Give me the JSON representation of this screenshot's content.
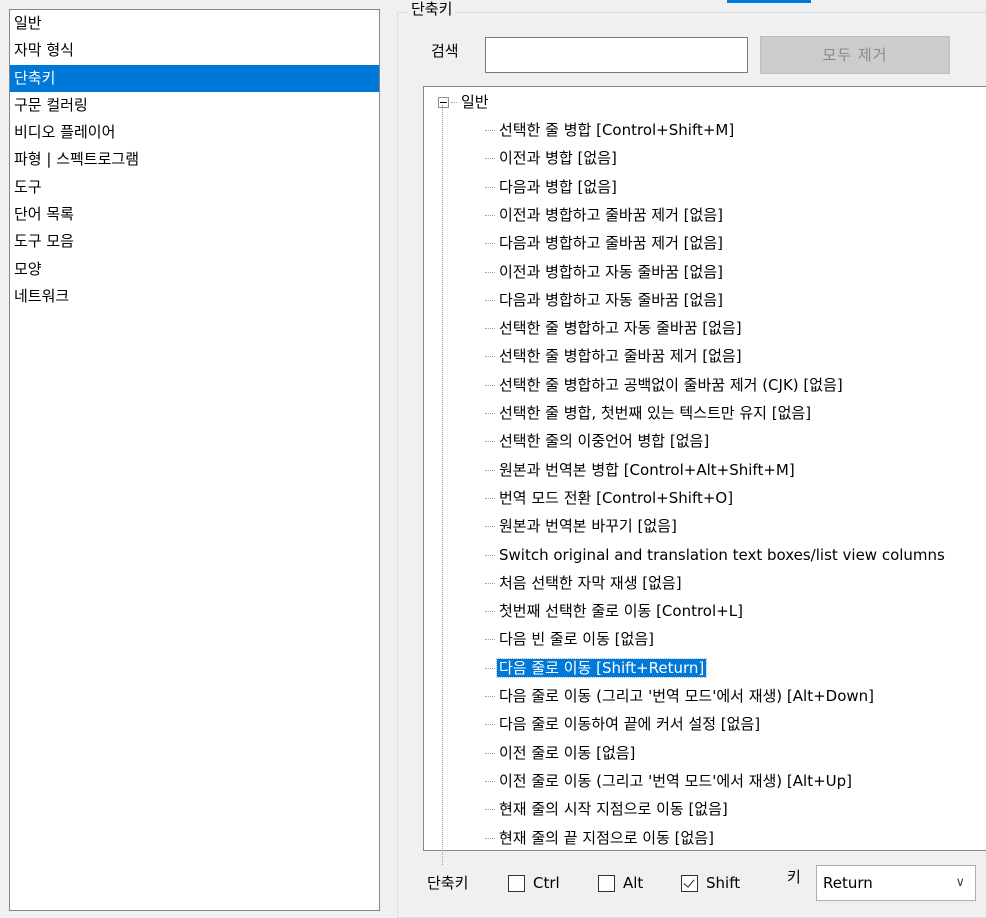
{
  "categories": [
    {
      "label": "일반"
    },
    {
      "label": "자막 형식"
    },
    {
      "label": "단축키",
      "selected": true
    },
    {
      "label": "구문 컬러링"
    },
    {
      "label": "비디오 플레이어"
    },
    {
      "label": "파형 | 스펙트로그램"
    },
    {
      "label": "도구"
    },
    {
      "label": "단어 목록"
    },
    {
      "label": "도구 모음"
    },
    {
      "label": "모양"
    },
    {
      "label": "네트워크"
    }
  ],
  "group_title": "단축키",
  "search": {
    "label": "검색",
    "value": "",
    "placeholder": ""
  },
  "clear_button": "모두 제거",
  "tree": {
    "root": "일반",
    "items": [
      "선택한 줄 병합 [Control+Shift+M]",
      "이전과 병합 [없음]",
      "다음과 병합 [없음]",
      "이전과 병합하고 줄바꿈 제거 [없음]",
      "다음과 병합하고 줄바꿈 제거 [없음]",
      "이전과 병합하고 자동 줄바꿈 [없음]",
      "다음과 병합하고 자동 줄바꿈 [없음]",
      "선택한 줄 병합하고 자동 줄바꿈 [없음]",
      "선택한 줄 병합하고 줄바꿈 제거 [없음]",
      "선택한 줄 병합하고 공백없이 줄바꿈 제거 (CJK) [없음]",
      "선택한 줄 병합, 첫번째 있는 텍스트만 유지 [없음]",
      "선택한 줄의 이중언어 병합 [없음]",
      "원본과 번역본 병합 [Control+Alt+Shift+M]",
      "번역 모드 전환 [Control+Shift+O]",
      "원본과 번역본 바꾸기 [없음]",
      "Switch original and translation text boxes/list view columns",
      "처음 선택한 자막 재생 [없음]",
      "첫번째 선택한 줄로 이동 [Control+L]",
      "다음 빈 줄로 이동 [없음]",
      "다음 줄로 이동 [Shift+Return]",
      "다음 줄로 이동 (그리고 '번역 모드'에서 재생) [Alt+Down]",
      "다음 줄로 이동하여 끝에 커서 설정 [없음]",
      "이전 줄로 이동 [없음]",
      "이전 줄로 이동 (그리고 '번역 모드'에서 재생) [Alt+Up]",
      "현재 줄의 시작 지점으로 이동 [없음]",
      "현재 줄의 끝 지점으로 이동 [없음]"
    ],
    "selected_index": 19
  },
  "bottom": {
    "shortcut_label": "단축키",
    "ctrl_label": "Ctrl",
    "ctrl_checked": false,
    "alt_label": "Alt",
    "alt_checked": false,
    "shift_label": "Shift",
    "shift_checked": true,
    "key_label": "키",
    "key_value": "Return"
  }
}
